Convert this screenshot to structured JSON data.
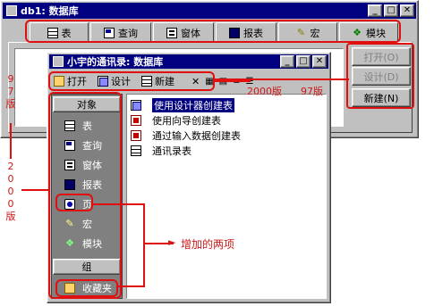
{
  "outer_window": {
    "title": "db1: 数据库",
    "tabs": [
      "表",
      "查询",
      "窗体",
      "报表",
      "宏",
      "模块"
    ],
    "buttons": {
      "open": "打开(O)",
      "design": "设计(D)",
      "new": "新建(N)"
    }
  },
  "inner_window": {
    "title": "小宇的通讯录: 数据库",
    "toolbar": {
      "open": "打开",
      "design": "设计",
      "new": "新建"
    },
    "objects_header": "对象",
    "objects": [
      "表",
      "查询",
      "窗体",
      "报表",
      "页",
      "宏",
      "模块"
    ],
    "groups_header": "组",
    "groups": [
      "收藏夹"
    ],
    "list_items": [
      "使用设计器创建表",
      "使用向导创建表",
      "通过输入数据创建表",
      "通讯录表"
    ]
  },
  "annotations": {
    "version_97": "97版",
    "version_2000": "2000版",
    "left_97": [
      "9",
      "7",
      "版"
    ],
    "left_2000": [
      "2",
      "0",
      "0",
      "0",
      "版"
    ],
    "added_two_items": "增加的两项"
  },
  "colors": {
    "accent_red": "#e01010",
    "titlebar": "#000080",
    "sidebar": "#808080"
  }
}
